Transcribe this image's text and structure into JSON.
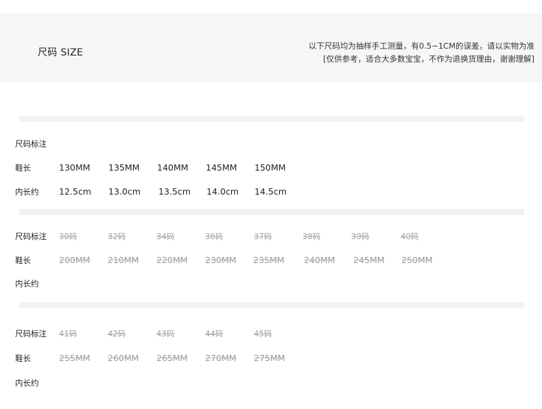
{
  "header": {
    "title": "尺码 SIZE",
    "note_line1": "以下尺码均为抽样手工测量，有0.5~1CM的误差，请以实物为准",
    "note_line2": "[仅供参考，适合大多数宝宝，不作为退换货理由，谢谢理解]"
  },
  "tables": [
    {
      "size_label": "尺码标注",
      "shoe_length_label": "鞋长",
      "inner_length_label": "内长约",
      "sizes": [],
      "shoe_lengths": [
        "130MM",
        "135MM",
        "140MM",
        "145MM",
        "150MM"
      ],
      "inner_lengths": [
        "12.5cm",
        "13.0cm",
        "13.5cm",
        "14.0cm",
        "14.5cm"
      ]
    },
    {
      "size_label": "尺码标注",
      "shoe_length_label": "鞋长",
      "inner_length_label": "内长约",
      "sizes": [
        "30码",
        "32码",
        "34码",
        "36码",
        "37码",
        "38码",
        "39码",
        "40码"
      ],
      "shoe_lengths": [
        "200MM",
        "210MM",
        "220MM",
        "230MM",
        "235MM",
        "240MM",
        "245MM",
        "250MM"
      ],
      "inner_lengths": []
    },
    {
      "size_label": "尺码标注",
      "shoe_length_label": "鞋长",
      "inner_length_label": "内长约",
      "sizes": [
        "41码",
        "42码",
        "43码",
        "44码",
        "45码"
      ],
      "shoe_lengths": [
        "255MM",
        "260MM",
        "265MM",
        "270MM",
        "275MM"
      ],
      "inner_lengths": []
    }
  ]
}
